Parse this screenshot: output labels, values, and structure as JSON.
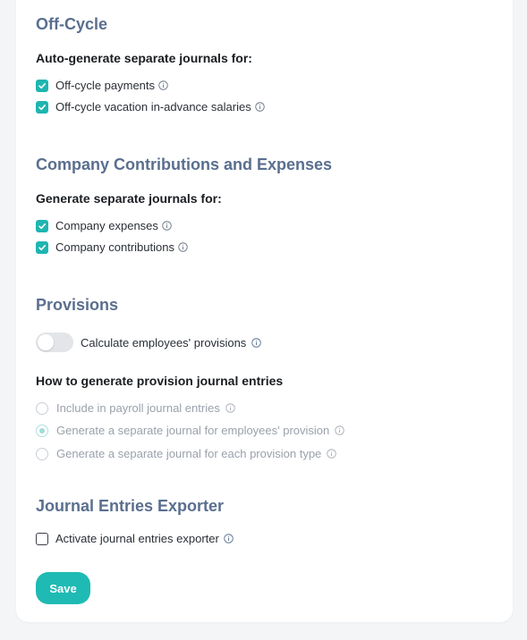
{
  "offcycle": {
    "title": "Off-Cycle",
    "subheading": "Auto-generate separate journals for:",
    "items": [
      {
        "label": "Off-cycle payments",
        "checked": true
      },
      {
        "label": "Off-cycle vacation in-advance salaries",
        "checked": true
      }
    ]
  },
  "contributions": {
    "title": "Company Contributions and Expenses",
    "subheading": "Generate separate journals for:",
    "items": [
      {
        "label": "Company expenses",
        "checked": true
      },
      {
        "label": "Company contributions",
        "checked": true
      }
    ]
  },
  "provisions": {
    "title": "Provisions",
    "toggle_label": "Calculate employees' provisions",
    "toggle_on": false,
    "subheading": "How to generate provision journal entries",
    "options": [
      {
        "label": "Include in payroll journal entries",
        "selected": false
      },
      {
        "label": "Generate a separate journal for employees' provision",
        "selected": true
      },
      {
        "label": "Generate a separate journal for each provision type",
        "selected": false
      }
    ]
  },
  "exporter": {
    "title": "Journal Entries Exporter",
    "checkbox_label": "Activate journal entries exporter",
    "checked": false
  },
  "actions": {
    "save_label": "Save"
  },
  "colors": {
    "accent": "#1fbab4",
    "section_title": "#5a6f8f",
    "disabled_text": "#9aa1ab"
  },
  "icons": {
    "check": "check-icon",
    "info": "info-circle-icon"
  }
}
